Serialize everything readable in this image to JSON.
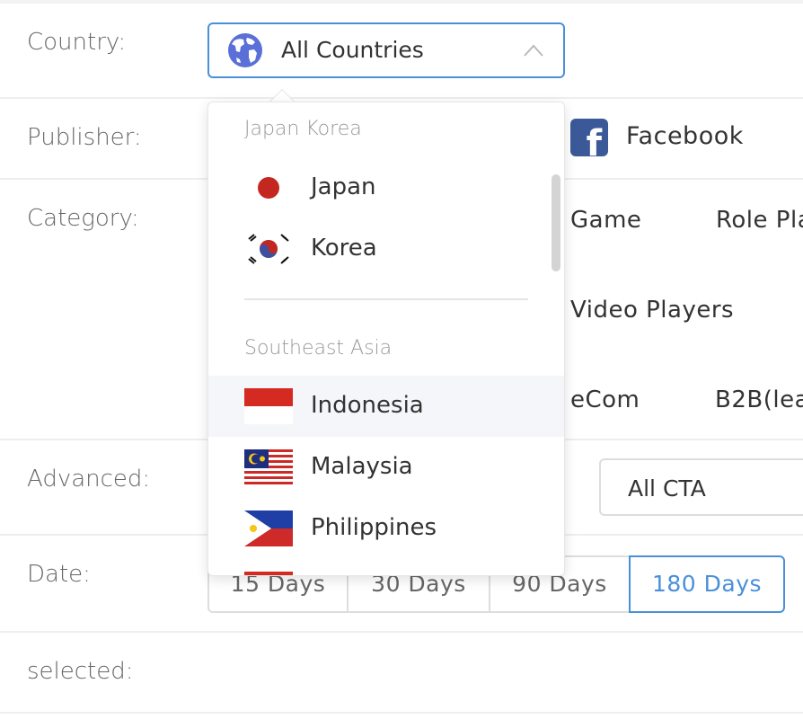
{
  "form": {
    "labels": {
      "country": "Country:",
      "publisher": "Publisher:",
      "category": "Category:",
      "advanced": "Advanced:",
      "date": "Date:",
      "selected": "selected:"
    },
    "country_select": {
      "value": "All Countries",
      "icon": "globe-icon",
      "open": true
    },
    "publisher": {
      "name": "Facebook",
      "icon": "facebook-icon"
    },
    "categories": [
      "Game",
      "Role Pla",
      "Video Players",
      "eCom",
      "B2B(lea"
    ],
    "advanced": {
      "cta_value": "All CTA"
    },
    "date_options": [
      "15 Days",
      "30 Days",
      "90 Days",
      "180 Days"
    ],
    "date_selected": "180 Days"
  },
  "dropdown": {
    "groups": [
      {
        "title": "Japan Korea",
        "options": [
          {
            "label": "Japan",
            "flag": "japan-flag"
          },
          {
            "label": "Korea",
            "flag": "korea-flag"
          }
        ]
      },
      {
        "title": "Southeast Asia",
        "options": [
          {
            "label": "Indonesia",
            "flag": "indonesia-flag",
            "hover": true
          },
          {
            "label": "Malaysia",
            "flag": "malaysia-flag"
          },
          {
            "label": "Philippines",
            "flag": "philippines-flag"
          }
        ]
      }
    ]
  },
  "colors": {
    "accent": "#4a90d9",
    "facebook": "#3b5998",
    "label": "#666666",
    "hover_bg": "#f5f6fa"
  }
}
